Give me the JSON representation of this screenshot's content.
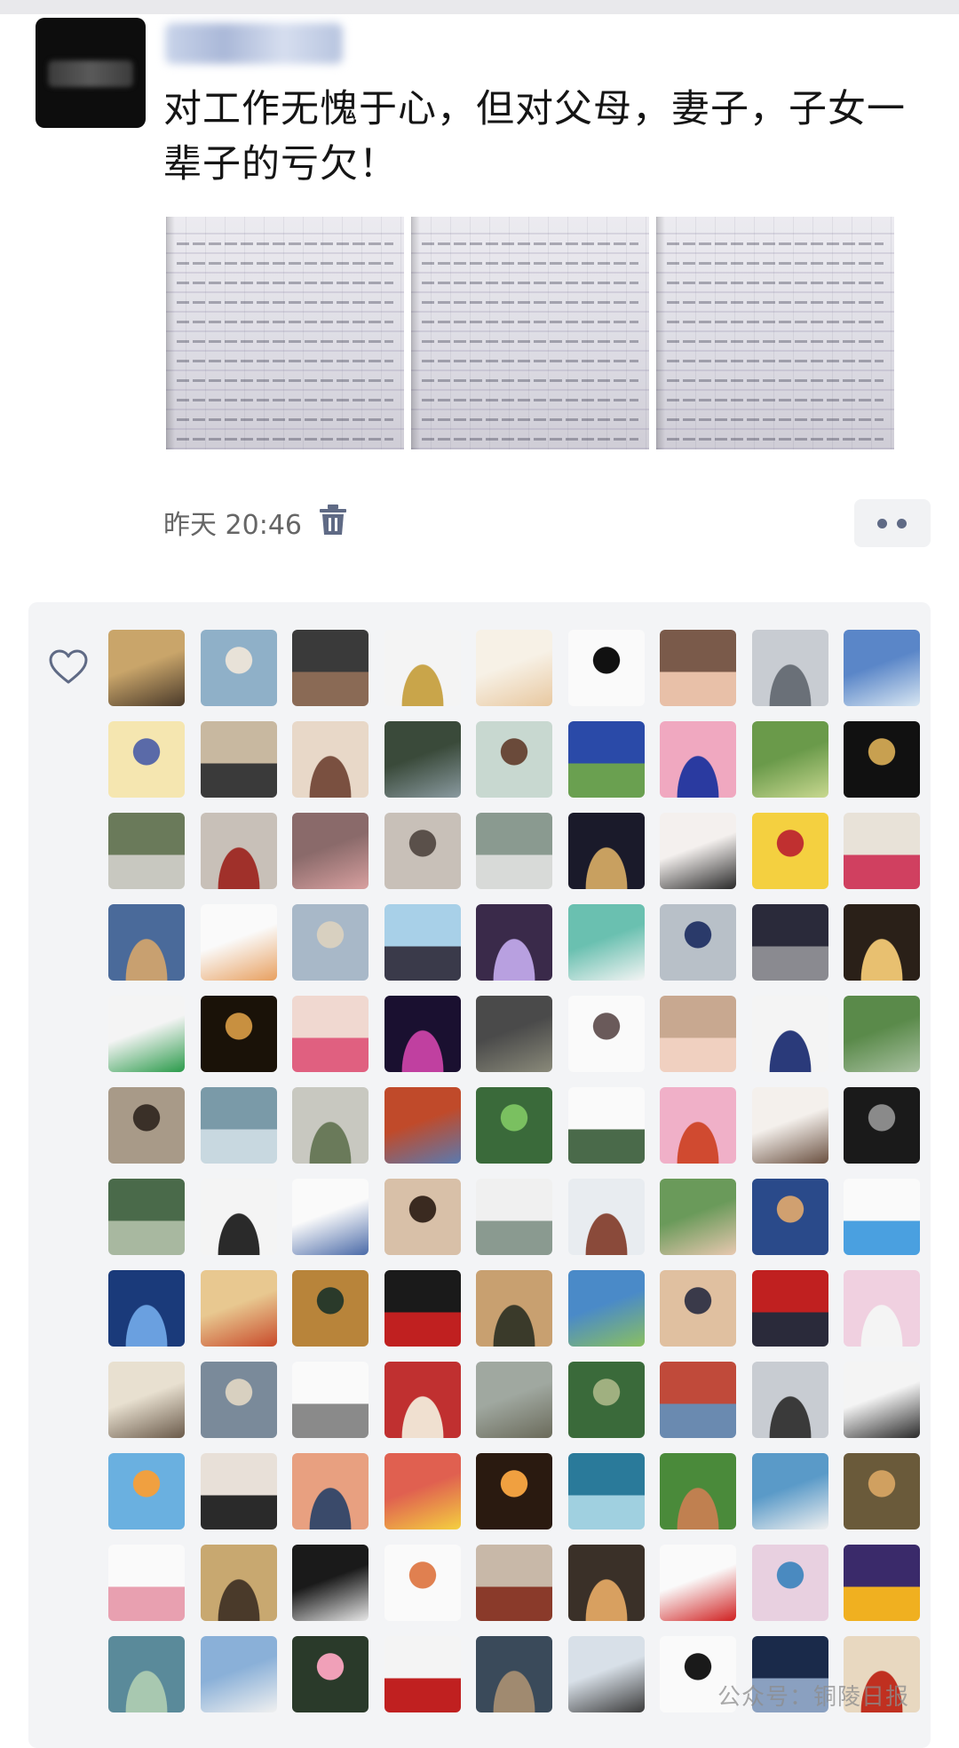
{
  "post": {
    "text": "对工作无愧于心，但对父母，妻子，子女一辈子的亏欠！",
    "time": "昨天 20:46",
    "photos": [
      {
        "name": "handwritten-essay-page-1"
      },
      {
        "name": "handwritten-essay-page-2"
      },
      {
        "name": "handwritten-essay-page-3"
      }
    ]
  },
  "icons": {
    "delete": "trash-icon",
    "more": "more-dots-icon",
    "like": "heart-icon"
  },
  "likes": {
    "avatar_colors": [
      [
        "#c9a56a",
        "#4a3a2a"
      ],
      [
        "#8fb0c8",
        "#e8e2d8"
      ],
      [
        "#3a3a3a",
        "#8a6a55"
      ],
      [
        "#f4f4f4",
        "#c9a54a"
      ],
      [
        "#f7f1e6",
        "#e8c8a0"
      ],
      [
        "#fafafa",
        "#111111"
      ],
      [
        "#7a5a4a",
        "#e8c0a8"
      ],
      [
        "#c8ccd2",
        "#6a7078"
      ],
      [
        "#5a86c8",
        "#d8e6f2"
      ],
      [
        "#f5e6b0",
        "#5a6aa8"
      ],
      [
        "#c8b8a0",
        "#3a3a3a"
      ],
      [
        "#e8d8c8",
        "#7a5040"
      ],
      [
        "#3a4a3a",
        "#8a9aa0"
      ],
      [
        "#c8d8d0",
        "#6a4a3a"
      ],
      [
        "#2a4aa8",
        "#6aa050"
      ],
      [
        "#f0a8c0",
        "#2a3aa0"
      ],
      [
        "#6a9a4a",
        "#c8d890"
      ],
      [
        "#111111",
        "#c8a050"
      ],
      [
        "#6a7a5a",
        "#c8c8c0"
      ],
      [
        "#c8c0b8",
        "#a0302a"
      ],
      [
        "#8a6a6a",
        "#d8a0a0"
      ],
      [
        "#c8c0b8",
        "#5a504a"
      ],
      [
        "#8a9a90",
        "#d8dad8"
      ],
      [
        "#1a1a2a",
        "#c8a060"
      ],
      [
        "#f4f0ee",
        "#2a2a2a"
      ],
      [
        "#f4d040",
        "#c03030"
      ],
      [
        "#e8e2d8",
        "#d04060"
      ],
      [
        "#4a6a9a",
        "#c8a070"
      ],
      [
        "#fafafa",
        "#e8a060"
      ],
      [
        "#a8b8c8",
        "#d8d0c0"
      ],
      [
        "#a8d0e8",
        "#3a3a4a"
      ],
      [
        "#3a2a4a",
        "#b8a0e0"
      ],
      [
        "#6ac0b0",
        "#f4f4f4"
      ],
      [
        "#b8c0c8",
        "#2a3a6a"
      ],
      [
        "#2a2a3a",
        "#8a8a90"
      ],
      [
        "#2a2018",
        "#e8c070"
      ],
      [
        "#f4f4f4",
        "#2a9a4a"
      ],
      [
        "#1a1208",
        "#c89040"
      ],
      [
        "#f0d8d0",
        "#e06080"
      ],
      [
        "#1a1030",
        "#c040a0"
      ],
      [
        "#4a4a4a",
        "#8a8a7a"
      ],
      [
        "#fafafa",
        "#6a5a5a"
      ],
      [
        "#c8a890",
        "#f0d0c0"
      ],
      [
        "#f4f4f4",
        "#2a3a7a"
      ],
      [
        "#5a8a4a",
        "#a8c0a0"
      ],
      [
        "#a89a88",
        "#3a3028"
      ],
      [
        "#7a9aa8",
        "#c8d8e0"
      ],
      [
        "#c8c8c0",
        "#6a7a5a"
      ],
      [
        "#c04a2a",
        "#5a7ab0"
      ],
      [
        "#3a6a3a",
        "#7ac060"
      ],
      [
        "#fafafa",
        "#4a6a4a"
      ],
      [
        "#f0b0c8",
        "#d04a30"
      ],
      [
        "#f4f0ec",
        "#6a5040"
      ],
      [
        "#1a1a1a",
        "#8a8a8a"
      ],
      [
        "#4a6a4a",
        "#a8b8a0"
      ],
      [
        "#f4f4f4",
        "#2a2a2a"
      ],
      [
        "#fafafa",
        "#4a6aa8"
      ],
      [
        "#d8c0a8",
        "#3a2a20"
      ],
      [
        "#f0f0f0",
        "#8a9a90"
      ],
      [
        "#e8ecf0",
        "#8a4a3a"
      ],
      [
        "#6a9a5a",
        "#e8c8b0"
      ],
      [
        "#2a4a8a",
        "#d0a070"
      ],
      [
        "#fafafa",
        "#4aa0e0"
      ],
      [
        "#1a3a7a",
        "#6aa0e0"
      ],
      [
        "#e8c890",
        "#c84a2a"
      ],
      [
        "#b8843a",
        "#2a3a2a"
      ],
      [
        "#1a1a1a",
        "#c02020"
      ],
      [
        "#c8a070",
        "#3a3a2a"
      ],
      [
        "#4a8ac8",
        "#8ac060"
      ],
      [
        "#e0c0a0",
        "#3a3a4a"
      ],
      [
        "#c02020",
        "#2a2a3a"
      ],
      [
        "#f0d0e0",
        "#f4f4f4"
      ],
      [
        "#e8e0d0",
        "#6a5a4a"
      ],
      [
        "#7a8a9a",
        "#d8d0c0"
      ],
      [
        "#fafafa",
        "#8a8a8a"
      ],
      [
        "#c03030",
        "#f0e0d0"
      ],
      [
        "#a0a8a0",
        "#6a6a5a"
      ],
      [
        "#3a6a3a",
        "#a0b080"
      ],
      [
        "#c04a3a",
        "#6a8ab0"
      ],
      [
        "#c8ccd2",
        "#3a3a3a"
      ],
      [
        "#f4f4f4",
        "#2a2a2a"
      ],
      [
        "#6ab0e0",
        "#f0a040"
      ],
      [
        "#e8e0d8",
        "#2a2a2a"
      ],
      [
        "#e8a080",
        "#3a4a6a"
      ],
      [
        "#e06050",
        "#f4d040"
      ],
      [
        "#2a1a10",
        "#f0a040"
      ],
      [
        "#2a7a9a",
        "#a0d0e0"
      ],
      [
        "#4a8a3a",
        "#c08050"
      ],
      [
        "#5a9ac8",
        "#f0f0f0"
      ],
      [
        "#6a5a3a",
        "#d0a060"
      ],
      [
        "#fafafa",
        "#e8a0b0"
      ],
      [
        "#c8a870",
        "#4a3a2a"
      ],
      [
        "#1a1a1a",
        "#e8e8e8"
      ],
      [
        "#fafafa",
        "#e08050"
      ],
      [
        "#c8b8a8",
        "#8a3a2a"
      ],
      [
        "#3a3028",
        "#d8a060"
      ],
      [
        "#fafafa",
        "#d02020"
      ],
      [
        "#e8d0e0",
        "#4a8ac0"
      ],
      [
        "#3a2a6a",
        "#f0b020"
      ],
      [
        "#5a8a9a",
        "#a8c8b0"
      ],
      [
        "#8ab0d8",
        "#f0f0f0"
      ],
      [
        "#2a3a2a",
        "#f0a0b8"
      ],
      [
        "#f4f4f4",
        "#c02020"
      ],
      [
        "#3a4a5a",
        "#a08a70"
      ],
      [
        "#d8e0e8",
        "#3a3a3a"
      ],
      [
        "#fafafa",
        "#1a1a1a"
      ],
      [
        "#1a2a4a",
        "#8aa0c0"
      ],
      [
        "#e8d8c0",
        "#c03020"
      ]
    ]
  },
  "watermark": "公众号：铜陵日报"
}
